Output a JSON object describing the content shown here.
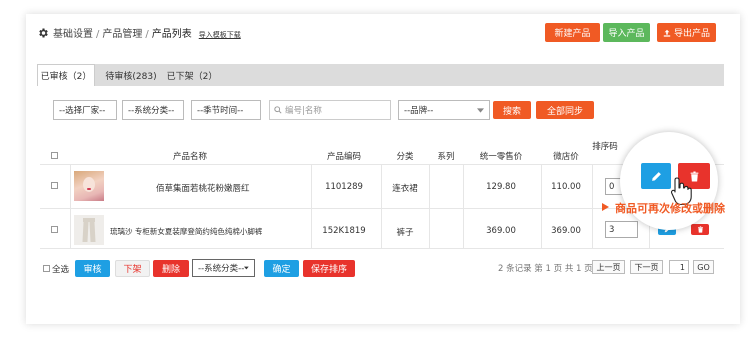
{
  "breadcrumb": {
    "items": [
      "基础设置",
      "产品管理",
      "产品列表"
    ],
    "separator": "/",
    "download_link": "导入模板下载"
  },
  "header_buttons": {
    "new_product": "新建产品",
    "import_product": "导入产品",
    "export_product": "导出产品"
  },
  "tabs": [
    {
      "label": "已审核（2）",
      "active": true
    },
    {
      "label": "待审核(283)",
      "active": false
    },
    {
      "label": "已下架（2）",
      "active": false
    }
  ],
  "filters": {
    "manufacturer": "--选择厂家--",
    "category": "--系统分类--",
    "season": "--季节时间--",
    "search_placeholder": "编号|名称",
    "brand": "--品牌--",
    "search_button": "搜索",
    "sync_button": "全部同步"
  },
  "table": {
    "headers": {
      "name": "产品名称",
      "code": "产品编码",
      "category": "分类",
      "series": "系列",
      "price": "统一零售价",
      "shop_price": "微店价",
      "sort": "排序码"
    },
    "rows": [
      {
        "name": "佰草集面若桃花粉嫩唇红",
        "code": "1101289",
        "category": "连衣裙",
        "series": "",
        "price": "129.80",
        "shop_price": "110.00",
        "sort": "0"
      },
      {
        "name": "琉璃沙 专柜新女夏装摩登简约纯色纯棉小脚裤",
        "code": "152K1819",
        "category": "裤子",
        "series": "",
        "price": "369.00",
        "shop_price": "369.00",
        "sort": "3"
      }
    ]
  },
  "callout": {
    "text": "商品可再次修改或删除"
  },
  "footer": {
    "select_all": "全选",
    "approve": "审核",
    "delist": "下架",
    "delete": "删除",
    "category_select": "--系统分类--",
    "confirm": "确定",
    "save_sort": "保存排序",
    "pagination_info": "2 条记录 第 1 页 共 1 页",
    "prev": "上一页",
    "next": "下一页",
    "page_input": "1",
    "go": "GO"
  },
  "colors": {
    "orange": "#f05a24",
    "green": "#5cb85c",
    "blue": "#1e9fe3",
    "red": "#e8332c"
  }
}
